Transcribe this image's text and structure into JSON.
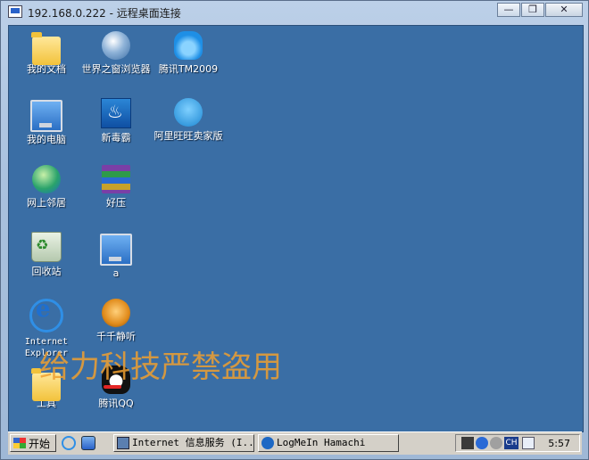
{
  "window": {
    "title": "192.168.0.222 - 远程桌面连接",
    "buttons": {
      "minimize": "—",
      "restore": "❐",
      "close": "✕"
    }
  },
  "desktop": {
    "background": "#3a6ea5",
    "icons": [
      {
        "label": "我的文档",
        "icon": "folder-documents-icon"
      },
      {
        "label": "世界之窗浏览器",
        "icon": "world-browser-icon"
      },
      {
        "label": "腾讯TM2009",
        "icon": "tencent-tm-icon"
      },
      {
        "label": "我的电脑",
        "icon": "my-computer-icon"
      },
      {
        "label": "新毒霸",
        "icon": "duba-antivirus-icon"
      },
      {
        "label": "阿里旺旺卖家版",
        "icon": "aliwangwang-icon"
      },
      {
        "label": "网上邻居",
        "icon": "network-places-icon"
      },
      {
        "label": "好压",
        "icon": "haozip-icon"
      },
      {
        "label": "回收站",
        "icon": "recycle-bin-icon"
      },
      {
        "label": "a",
        "icon": "shortcut-computer-icon"
      },
      {
        "label": "Internet Explorer",
        "icon": "internet-explorer-icon"
      },
      {
        "label": "千千静听",
        "icon": "ttplayer-icon"
      },
      {
        "label": "工具",
        "icon": "tools-folder-icon"
      },
      {
        "label": "腾讯QQ",
        "icon": "qq-icon"
      }
    ],
    "watermark": "给力科技严禁盗用"
  },
  "taskbar": {
    "start_label": "开始",
    "tasks": [
      {
        "label": "Internet 信息服务 (I..."
      },
      {
        "label": "LogMeIn Hamachi"
      }
    ],
    "tray": {
      "language": "CH",
      "clock": "5:57"
    }
  }
}
